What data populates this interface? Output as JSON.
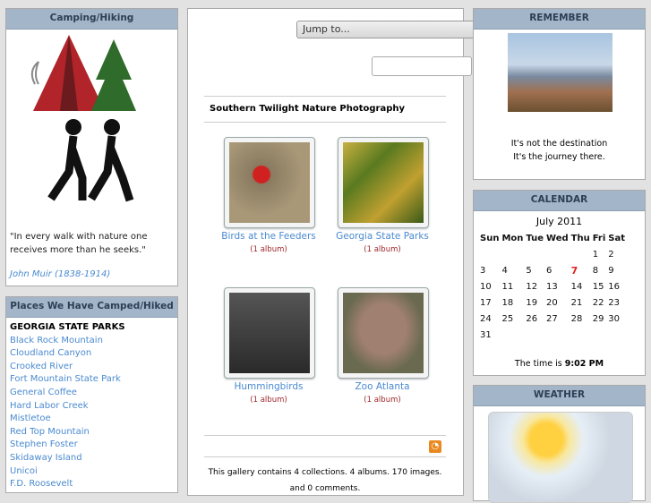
{
  "left": {
    "camping_title": "Camping/Hiking",
    "quote": "\"In every walk with nature one receives more than he seeks.\"",
    "author": "John Muir (1838-1914)",
    "places_title": "Places We Have Camped/Hiked",
    "places_heading": "GEORGIA STATE PARKS",
    "places": [
      "Black Rock Mountain",
      "Cloudland Canyon",
      "Crooked River",
      "Fort Mountain State Park",
      "General Coffee",
      "Hard Labor Creek",
      "Mistletoe",
      "Red Top Mountain",
      "Stephen Foster",
      "Skidaway Island",
      "Unicoi",
      "F.D. Roosevelt"
    ]
  },
  "center": {
    "jump_label": "Jump to...",
    "search_value": "",
    "title": "Southern Twilight Nature Photography",
    "albums": [
      {
        "name": "Birds at the Feeders",
        "count": "(1 album)"
      },
      {
        "name": "Georgia State Parks",
        "count": "(1 album)"
      },
      {
        "name": "Hummingbirds",
        "count": "(1 album)"
      },
      {
        "name": "Zoo Atlanta",
        "count": "(1 album)"
      }
    ],
    "footer": "This gallery contains 4 collections. 4 albums. 170 images. and 0 comments."
  },
  "right": {
    "remember_title": "REMEMBER",
    "remember_line1": "It's not the destination",
    "remember_line2": "It's the journey there.",
    "calendar_title": "CALENDAR",
    "month": "July 2011",
    "days": [
      "Sun",
      "Mon",
      "Tue",
      "Wed",
      "Thu",
      "Fri",
      "Sat"
    ],
    "weeks": [
      [
        "",
        "",
        "",
        "",
        "",
        "1",
        "2"
      ],
      [
        "3",
        "4",
        "5",
        "6",
        "7",
        "8",
        "9"
      ],
      [
        "10",
        "11",
        "12",
        "13",
        "14",
        "15",
        "16"
      ],
      [
        "17",
        "18",
        "19",
        "20",
        "21",
        "22",
        "23"
      ],
      [
        "24",
        "25",
        "26",
        "27",
        "28",
        "29",
        "30"
      ],
      [
        "31",
        "",
        "",
        "",
        "",
        "",
        ""
      ]
    ],
    "today": "7",
    "time_prefix": "The time is ",
    "time": "9:02 PM",
    "weather_title": "WEATHER"
  },
  "colors": {
    "header": "#a3b5c9",
    "link": "#4a8ad0",
    "count": "#a0262a",
    "today": "#e02020"
  }
}
